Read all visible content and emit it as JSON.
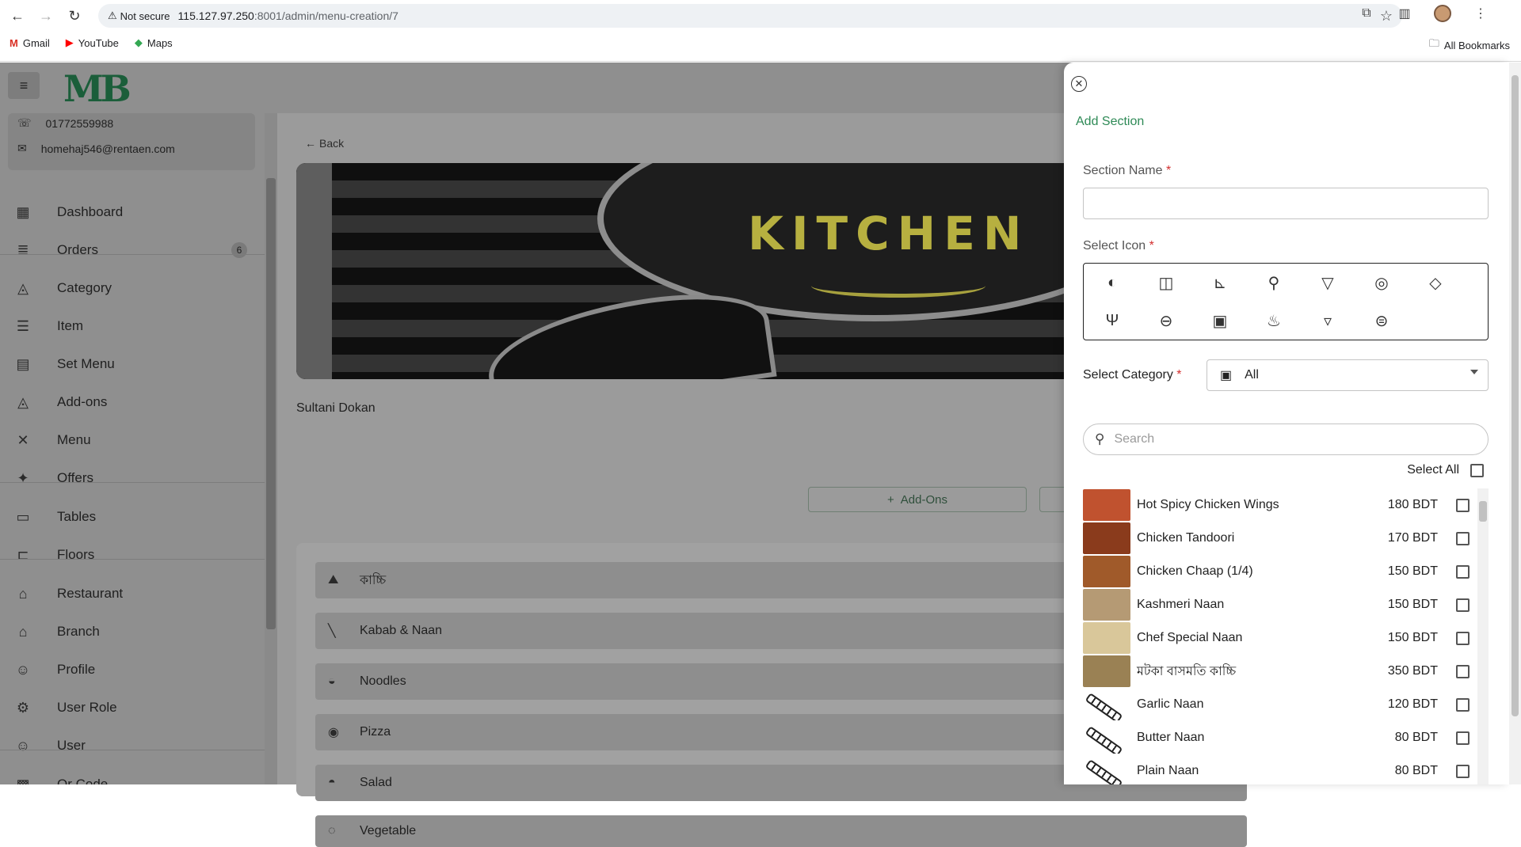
{
  "browser": {
    "security": "Not secure",
    "url_host": "115.127.97.250",
    "url_rest": ":8001/admin/menu-creation/7",
    "bookmarks": [
      "Gmail",
      "YouTube",
      "Maps"
    ],
    "all_bookmarks": "All Bookmarks"
  },
  "app": {
    "logo": "MB",
    "contact": {
      "phone": "01772559988",
      "email": "homehaj546@rentaen.com"
    },
    "sidebar": [
      {
        "label": "Dashboard",
        "icon": "dashboard-icon"
      },
      {
        "label": "Orders",
        "icon": "orders-icon",
        "badge": "6"
      },
      {
        "label": "Category",
        "icon": "category-icon"
      },
      {
        "label": "Item",
        "icon": "item-icon"
      },
      {
        "label": "Set Menu",
        "icon": "set-menu-icon"
      },
      {
        "label": "Add-ons",
        "icon": "add-ons-icon"
      },
      {
        "label": "Menu",
        "icon": "menu-icon"
      },
      {
        "label": "Offers",
        "icon": "offers-icon"
      },
      {
        "label": "Tables",
        "icon": "tables-icon"
      },
      {
        "label": "Floors",
        "icon": "floors-icon"
      },
      {
        "label": "Restaurant",
        "icon": "restaurant-icon"
      },
      {
        "label": "Branch",
        "icon": "branch-icon"
      },
      {
        "label": "Profile",
        "icon": "profile-icon"
      },
      {
        "label": "User Role",
        "icon": "user-role-icon"
      },
      {
        "label": "User",
        "icon": "user-icon"
      },
      {
        "label": "Qr Code",
        "icon": "qr-code-icon"
      }
    ]
  },
  "content": {
    "back": "Back",
    "banner_text": "KITCHEN",
    "shop_name": "Sultani Dokan",
    "addons_button": "Add-Ons",
    "sections": [
      {
        "label": "কাচ্চি",
        "icon": "biryani-icon"
      },
      {
        "label": "Kabab & Naan",
        "icon": "kabab-icon"
      },
      {
        "label": "Noodles",
        "icon": "noodles-icon"
      },
      {
        "label": "Pizza",
        "icon": "pizza-icon"
      },
      {
        "label": "Salad",
        "icon": "salad-icon"
      },
      {
        "label": "Vegetable",
        "icon": "vegetable-icon"
      }
    ]
  },
  "drawer": {
    "title": "Add Section",
    "section_name_label": "Section Name",
    "select_icon_label": "Select Icon",
    "select_category_label": "Select Category",
    "category_value": "All",
    "search_placeholder": "Search",
    "select_all": "Select All",
    "required_mark": "*",
    "icons": [
      "steak-icon",
      "cup-icon",
      "chair-icon",
      "drumstick-icon",
      "cocktail-icon",
      "bowl-icon",
      "pizza-slice-icon",
      "fork-knife-icon",
      "burger-icon",
      "menu-board-icon",
      "noodles-icon",
      "drink-cup-icon",
      "salad-bowl-icon"
    ],
    "items": [
      {
        "name": "Hot Spicy Chicken Wings",
        "price": "180 BDT",
        "thumb": "photo"
      },
      {
        "name": "Chicken Tandoori",
        "price": "170 BDT",
        "thumb": "photo"
      },
      {
        "name": "Chicken Chaap (1/4)",
        "price": "150 BDT",
        "thumb": "photo"
      },
      {
        "name": "Kashmeri Naan",
        "price": "150 BDT",
        "thumb": "photo"
      },
      {
        "name": "Chef Special Naan",
        "price": "150 BDT",
        "thumb": "photo"
      },
      {
        "name": "মটকা বাসমতি কাচ্চি",
        "price": "350 BDT",
        "thumb": "photo"
      },
      {
        "name": "Garlic Naan",
        "price": "120 BDT",
        "thumb": "skewer"
      },
      {
        "name": "Butter Naan",
        "price": "80 BDT",
        "thumb": "skewer"
      },
      {
        "name": "Plain Naan",
        "price": "80 BDT",
        "thumb": "skewer"
      }
    ]
  }
}
